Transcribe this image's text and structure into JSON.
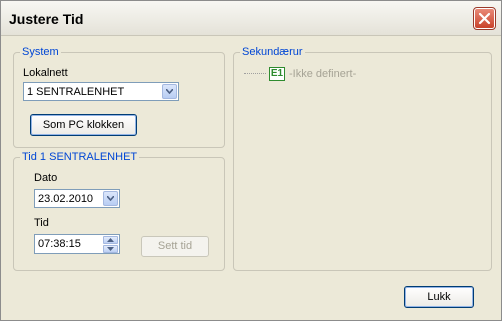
{
  "window": {
    "title": "Justere Tid"
  },
  "system": {
    "legend": "System",
    "network_label": "Lokalnett",
    "network_value": "1 SENTRALENHET",
    "pc_clock_button": "Som PC klokken"
  },
  "time_group": {
    "legend": "Tid 1 SENTRALENHET",
    "date_label": "Dato",
    "date_value": "23.02.2010",
    "time_label": "Tid",
    "time_value": "07:38:15",
    "set_time_button": "Sett tid"
  },
  "secondary": {
    "legend": "Sekundærur",
    "tree_items": [
      {
        "badge": "E1",
        "label": "-Ikke definert-"
      }
    ]
  },
  "footer": {
    "close_button": "Lukk"
  },
  "colors": {
    "legend": "#0046d5",
    "badge": "#2e8b2e",
    "disabled_text": "#a6a395"
  },
  "icons": {
    "close": "close-x-icon",
    "dropdown": "chevron-down-icon",
    "spinner": "spin-arrows-icon"
  }
}
